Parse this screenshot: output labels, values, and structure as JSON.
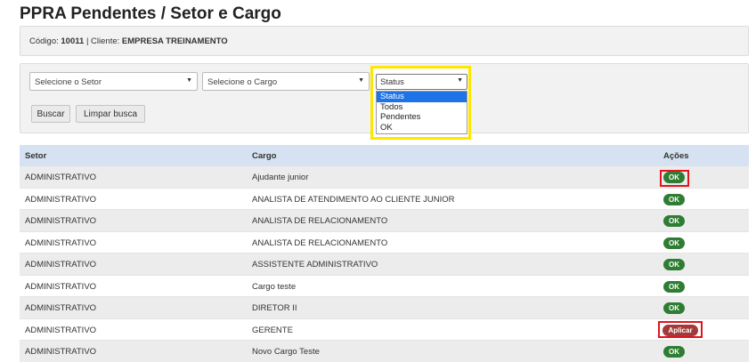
{
  "page": {
    "title": "PPRA Pendentes / Setor e Cargo"
  },
  "info": {
    "code_label": "Código:",
    "code_value": "10011",
    "separator": "|",
    "client_label": "Cliente:",
    "client_value": "EMPRESA TREINAMENTO"
  },
  "filters": {
    "setor_placeholder": "Selecione o Setor",
    "cargo_placeholder": "Selecione o Cargo",
    "status_value": "Status",
    "status_options": [
      "Status",
      "Todos",
      "Pendentes",
      "OK"
    ],
    "search_button": "Buscar",
    "clear_button": "Limpar busca",
    "arrow_glyph": "▼"
  },
  "table": {
    "headers": {
      "setor": "Setor",
      "cargo": "Cargo",
      "acoes": "Ações"
    },
    "rows": [
      {
        "setor": "ADMINISTRATIVO",
        "cargo": "Ajudante junior",
        "acao": "OK"
      },
      {
        "setor": "ADMINISTRATIVO",
        "cargo": "ANALISTA DE ATENDIMENTO AO CLIENTE JUNIOR",
        "acao": "OK"
      },
      {
        "setor": "ADMINISTRATIVO",
        "cargo": "ANALISTA DE RELACIONAMENTO",
        "acao": "OK"
      },
      {
        "setor": "ADMINISTRATIVO",
        "cargo": "ANALISTA DE RELACIONAMENTO",
        "acao": "OK"
      },
      {
        "setor": "ADMINISTRATIVO",
        "cargo": "ASSISTENTE ADMINISTRATIVO",
        "acao": "OK"
      },
      {
        "setor": "ADMINISTRATIVO",
        "cargo": "Cargo teste",
        "acao": "OK"
      },
      {
        "setor": "ADMINISTRATIVO",
        "cargo": "DIRETOR II",
        "acao": "OK"
      },
      {
        "setor": "ADMINISTRATIVO",
        "cargo": "GERENTE",
        "acao": "Aplicar"
      },
      {
        "setor": "ADMINISTRATIVO",
        "cargo": "Novo Cargo Teste",
        "acao": "OK"
      }
    ]
  },
  "colors": {
    "ok_badge": "#2e7d32",
    "apply_badge": "#a33a3a",
    "header_bg": "#d6e2f1",
    "highlight_yellow": "#ffe600",
    "highlight_red": "#e0141e",
    "selected_option": "#1e73e8"
  }
}
